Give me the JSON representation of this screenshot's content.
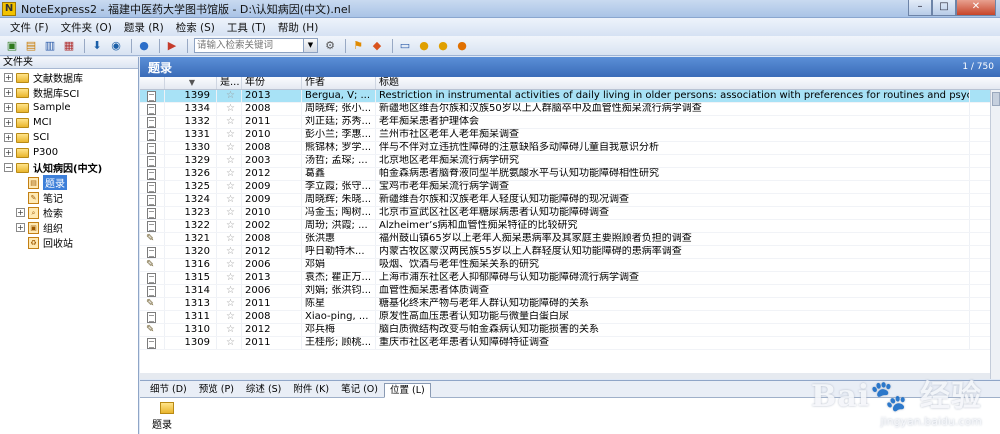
{
  "window": {
    "title": "NoteExpress2 - 福建中医药大学图书馆版 - D:\\认知病因(中文).nel",
    "logo_letter": "N",
    "btn_minimize": "–",
    "btn_maximize": "□",
    "btn_close": "✕"
  },
  "menu": [
    "文件 (F)",
    "文件夹 (O)",
    "题录 (R)",
    "检索 (S)",
    "工具 (T)",
    "帮助 (H)"
  ],
  "toolbar": {
    "search_placeholder": "请输入检索关键词"
  },
  "folders": {
    "header": "文件夹",
    "items": [
      {
        "label": "文献数据库",
        "toggle": "+"
      },
      {
        "label": "数据库SCI",
        "toggle": "+"
      },
      {
        "label": "Sample",
        "toggle": "+"
      },
      {
        "label": "MCI",
        "toggle": "+"
      },
      {
        "label": "SCI",
        "toggle": "+"
      },
      {
        "label": "P300",
        "toggle": "+"
      },
      {
        "label": "认知病因(中文)",
        "toggle": "−"
      }
    ],
    "sub_items": [
      {
        "label": "题录"
      },
      {
        "label": "笔记"
      },
      {
        "label": "检索",
        "toggle": "+"
      },
      {
        "label": "组织",
        "toggle": "+"
      },
      {
        "label": "回收站"
      }
    ]
  },
  "main": {
    "title": "题录",
    "count": "1 / 750",
    "columns": {
      "read": "是...",
      "year": "年份",
      "author": "作者",
      "title": "标题"
    },
    "rows": [
      {
        "id": "1399",
        "year": "2013",
        "author": "Bergua, V; ...",
        "title": "Restriction in instrumental activities of daily living in older persons: association with preferences for routines and psychological...",
        "note": false,
        "selected": true
      },
      {
        "id": "1334",
        "year": "2008",
        "author": "周晓辉; 张小...",
        "title": "新疆地区维吾尔族和汉族50岁以上人群脑卒中及血管性痴呆流行病学调查",
        "note": false
      },
      {
        "id": "1332",
        "year": "2011",
        "author": "刘正廷; 苏秀...",
        "title": "老年痴呆患者护理体会",
        "note": false
      },
      {
        "id": "1331",
        "year": "2010",
        "author": "彭小兰; 李惠...",
        "title": "兰州市社区老年人老年痴呆调查",
        "note": false
      },
      {
        "id": "1330",
        "year": "2008",
        "author": "熊锦林; 罗学...",
        "title": "伴与不伴对立违抗性障碍的注意缺陷多动障碍儿童自我意识分析",
        "note": false
      },
      {
        "id": "1329",
        "year": "2003",
        "author": "汤哲; 孟琛; ...",
        "title": "北京地区老年痴呆流行病学研究",
        "note": false
      },
      {
        "id": "1326",
        "year": "2012",
        "author": "葛鑫",
        "title": "帕金森病患者脑脊液同型半胱氨酸水平与认知功能障碍相性研究",
        "note": false
      },
      {
        "id": "1325",
        "year": "2009",
        "author": "李立霞; 张守...",
        "title": "宝鸡市老年痴呆流行病学调查",
        "note": false
      },
      {
        "id": "1324",
        "year": "2009",
        "author": "周晓辉; 朱晓...",
        "title": "新疆维吾尔族和汉族老年人轻度认知功能障碍的现况调查",
        "note": false
      },
      {
        "id": "1323",
        "year": "2010",
        "author": "冯金玉; 陶树...",
        "title": "北京市宣武区社区老年糖尿病患者认知功能障碍调查",
        "note": false
      },
      {
        "id": "1322",
        "year": "2002",
        "author": "周玢; 洪霞; ...",
        "title": "Alzheimer’s病和血管性痴呆特征的比较研究",
        "note": false
      },
      {
        "id": "1321",
        "year": "2008",
        "author": "张洪惠",
        "title": "福州鼓山镇65岁以上老年人痴呆患病率及其家庭主要照顾者负担的调查",
        "note": true
      },
      {
        "id": "1320",
        "year": "2012",
        "author": "呼日勒特木...",
        "title": "内蒙古牧区蒙汉两民族55岁以上人群轻度认知功能障碍的患病率调查",
        "note": false
      },
      {
        "id": "1316",
        "year": "2006",
        "author": "邓娟",
        "title": "吸烟、饮酒与老年性痴呆关系的研究",
        "note": true
      },
      {
        "id": "1315",
        "year": "2013",
        "author": "袁杰; 瞿正万...",
        "title": "上海市浦东社区老人抑郁障碍与认知功能障碍流行病学调查",
        "note": false
      },
      {
        "id": "1314",
        "year": "2006",
        "author": "刘娟; 张洪钧...",
        "title": "血管性痴呆患者体质调查",
        "note": false
      },
      {
        "id": "1313",
        "year": "2011",
        "author": "陈星",
        "title": "糖基化终末产物与老年人群认知功能障碍的关系",
        "note": true
      },
      {
        "id": "1311",
        "year": "2008",
        "author": "Xiao-ping, ...",
        "title": "原发性高血压患者认知功能与微量白蛋白尿",
        "note": false
      },
      {
        "id": "1310",
        "year": "2012",
        "author": "邓兵梅",
        "title": "脑白质微结构改变与帕金森病认知功能损害的关系",
        "note": true
      },
      {
        "id": "1309",
        "year": "2011",
        "author": "王桂彤; 顾桃...",
        "title": "重庆市社区老年患者认知障碍特征调查",
        "note": false
      }
    ]
  },
  "bottom": {
    "tabs": [
      "细节 (D)",
      "预览 (P)",
      "综述 (S)",
      "附件 (K)",
      "笔记 (O)",
      "位置 (L)"
    ],
    "active_tab": 5,
    "location_label": "题录"
  },
  "watermark": {
    "main": "Bai🐾 经验",
    "sub": "jingyan.baidu.com"
  },
  "colors": {
    "header_blue": "#3a6cb8",
    "selected_row": "#a8e2f6",
    "close_red": "#c6452a"
  }
}
